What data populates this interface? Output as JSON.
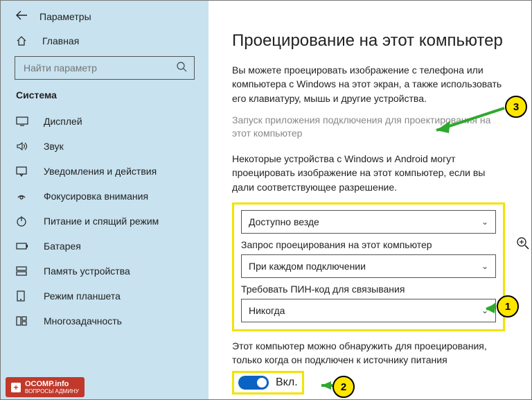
{
  "header": {
    "title": "Параметры"
  },
  "sidebar": {
    "home": "Главная",
    "search_placeholder": "Найти параметр",
    "section": "Система",
    "items": [
      {
        "label": "Дисплей"
      },
      {
        "label": "Звук"
      },
      {
        "label": "Уведомления и действия"
      },
      {
        "label": "Фокусировка внимания"
      },
      {
        "label": "Питание и спящий режим"
      },
      {
        "label": "Батарея"
      },
      {
        "label": "Память устройства"
      },
      {
        "label": "Режим планшета"
      },
      {
        "label": "Многозадачность"
      }
    ]
  },
  "main": {
    "heading": "Проецирование на этот компьютер",
    "intro": "Вы можете проецировать изображение с телефона или компьютера с Windows на этот экран, а также использовать его клавиатуру, мышь и другие устройства.",
    "launch_link": "Запуск приложения подключения для проектирования на этот компьютер",
    "desc": "Некоторые устройства с Windows и Android могут проецировать изображение на этот компьютер, если вы дали соответствующее разрешение.",
    "select1_value": "Доступно везде",
    "label2": "Запрос проецирования на этот компьютер",
    "select2_value": "При каждом подключении",
    "label3": "Требовать ПИН-код для связывания",
    "select3_value": "Никогда",
    "note": "Этот компьютер можно обнаружить для проецирования, только когда он подключен к источнику питания",
    "toggle_label": "Вкл."
  },
  "markers": {
    "m1": "1",
    "m2": "2",
    "m3": "3"
  },
  "watermark": {
    "brand": "OCOMP.info",
    "sub": "ВОПРОСЫ АДМИНУ"
  }
}
